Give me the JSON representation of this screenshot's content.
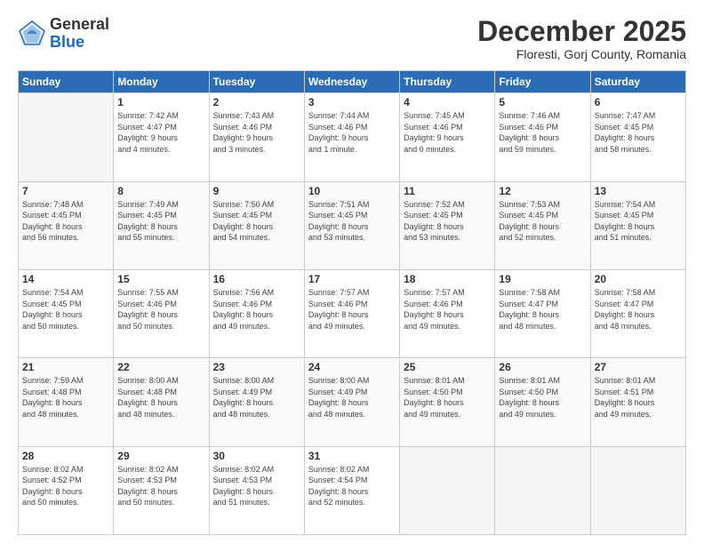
{
  "logo": {
    "general": "General",
    "blue": "Blue"
  },
  "title": "December 2025",
  "location": "Floresti, Gorj County, Romania",
  "weekdays": [
    "Sunday",
    "Monday",
    "Tuesday",
    "Wednesday",
    "Thursday",
    "Friday",
    "Saturday"
  ],
  "weeks": [
    [
      {
        "num": "",
        "info": ""
      },
      {
        "num": "1",
        "info": "Sunrise: 7:42 AM\nSunset: 4:47 PM\nDaylight: 9 hours\nand 4 minutes."
      },
      {
        "num": "2",
        "info": "Sunrise: 7:43 AM\nSunset: 4:46 PM\nDaylight: 9 hours\nand 3 minutes."
      },
      {
        "num": "3",
        "info": "Sunrise: 7:44 AM\nSunset: 4:46 PM\nDaylight: 9 hours\nand 1 minute."
      },
      {
        "num": "4",
        "info": "Sunrise: 7:45 AM\nSunset: 4:46 PM\nDaylight: 9 hours\nand 0 minutes."
      },
      {
        "num": "5",
        "info": "Sunrise: 7:46 AM\nSunset: 4:46 PM\nDaylight: 8 hours\nand 59 minutes."
      },
      {
        "num": "6",
        "info": "Sunrise: 7:47 AM\nSunset: 4:45 PM\nDaylight: 8 hours\nand 58 minutes."
      }
    ],
    [
      {
        "num": "7",
        "info": "Sunrise: 7:48 AM\nSunset: 4:45 PM\nDaylight: 8 hours\nand 56 minutes."
      },
      {
        "num": "8",
        "info": "Sunrise: 7:49 AM\nSunset: 4:45 PM\nDaylight: 8 hours\nand 55 minutes."
      },
      {
        "num": "9",
        "info": "Sunrise: 7:50 AM\nSunset: 4:45 PM\nDaylight: 8 hours\nand 54 minutes."
      },
      {
        "num": "10",
        "info": "Sunrise: 7:51 AM\nSunset: 4:45 PM\nDaylight: 8 hours\nand 53 minutes."
      },
      {
        "num": "11",
        "info": "Sunrise: 7:52 AM\nSunset: 4:45 PM\nDaylight: 8 hours\nand 53 minutes."
      },
      {
        "num": "12",
        "info": "Sunrise: 7:53 AM\nSunset: 4:45 PM\nDaylight: 8 hours\nand 52 minutes."
      },
      {
        "num": "13",
        "info": "Sunrise: 7:54 AM\nSunset: 4:45 PM\nDaylight: 8 hours\nand 51 minutes."
      }
    ],
    [
      {
        "num": "14",
        "info": "Sunrise: 7:54 AM\nSunset: 4:45 PM\nDaylight: 8 hours\nand 50 minutes."
      },
      {
        "num": "15",
        "info": "Sunrise: 7:55 AM\nSunset: 4:46 PM\nDaylight: 8 hours\nand 50 minutes."
      },
      {
        "num": "16",
        "info": "Sunrise: 7:56 AM\nSunset: 4:46 PM\nDaylight: 8 hours\nand 49 minutes."
      },
      {
        "num": "17",
        "info": "Sunrise: 7:57 AM\nSunset: 4:46 PM\nDaylight: 8 hours\nand 49 minutes."
      },
      {
        "num": "18",
        "info": "Sunrise: 7:57 AM\nSunset: 4:46 PM\nDaylight: 8 hours\nand 49 minutes."
      },
      {
        "num": "19",
        "info": "Sunrise: 7:58 AM\nSunset: 4:47 PM\nDaylight: 8 hours\nand 48 minutes."
      },
      {
        "num": "20",
        "info": "Sunrise: 7:58 AM\nSunset: 4:47 PM\nDaylight: 8 hours\nand 48 minutes."
      }
    ],
    [
      {
        "num": "21",
        "info": "Sunrise: 7:59 AM\nSunset: 4:48 PM\nDaylight: 8 hours\nand 48 minutes."
      },
      {
        "num": "22",
        "info": "Sunrise: 8:00 AM\nSunset: 4:48 PM\nDaylight: 8 hours\nand 48 minutes."
      },
      {
        "num": "23",
        "info": "Sunrise: 8:00 AM\nSunset: 4:49 PM\nDaylight: 8 hours\nand 48 minutes."
      },
      {
        "num": "24",
        "info": "Sunrise: 8:00 AM\nSunset: 4:49 PM\nDaylight: 8 hours\nand 48 minutes."
      },
      {
        "num": "25",
        "info": "Sunrise: 8:01 AM\nSunset: 4:50 PM\nDaylight: 8 hours\nand 49 minutes."
      },
      {
        "num": "26",
        "info": "Sunrise: 8:01 AM\nSunset: 4:50 PM\nDaylight: 8 hours\nand 49 minutes."
      },
      {
        "num": "27",
        "info": "Sunrise: 8:01 AM\nSunset: 4:51 PM\nDaylight: 8 hours\nand 49 minutes."
      }
    ],
    [
      {
        "num": "28",
        "info": "Sunrise: 8:02 AM\nSunset: 4:52 PM\nDaylight: 8 hours\nand 50 minutes."
      },
      {
        "num": "29",
        "info": "Sunrise: 8:02 AM\nSunset: 4:53 PM\nDaylight: 8 hours\nand 50 minutes."
      },
      {
        "num": "30",
        "info": "Sunrise: 8:02 AM\nSunset: 4:53 PM\nDaylight: 8 hours\nand 51 minutes."
      },
      {
        "num": "31",
        "info": "Sunrise: 8:02 AM\nSunset: 4:54 PM\nDaylight: 8 hours\nand 52 minutes."
      },
      {
        "num": "",
        "info": ""
      },
      {
        "num": "",
        "info": ""
      },
      {
        "num": "",
        "info": ""
      }
    ]
  ]
}
